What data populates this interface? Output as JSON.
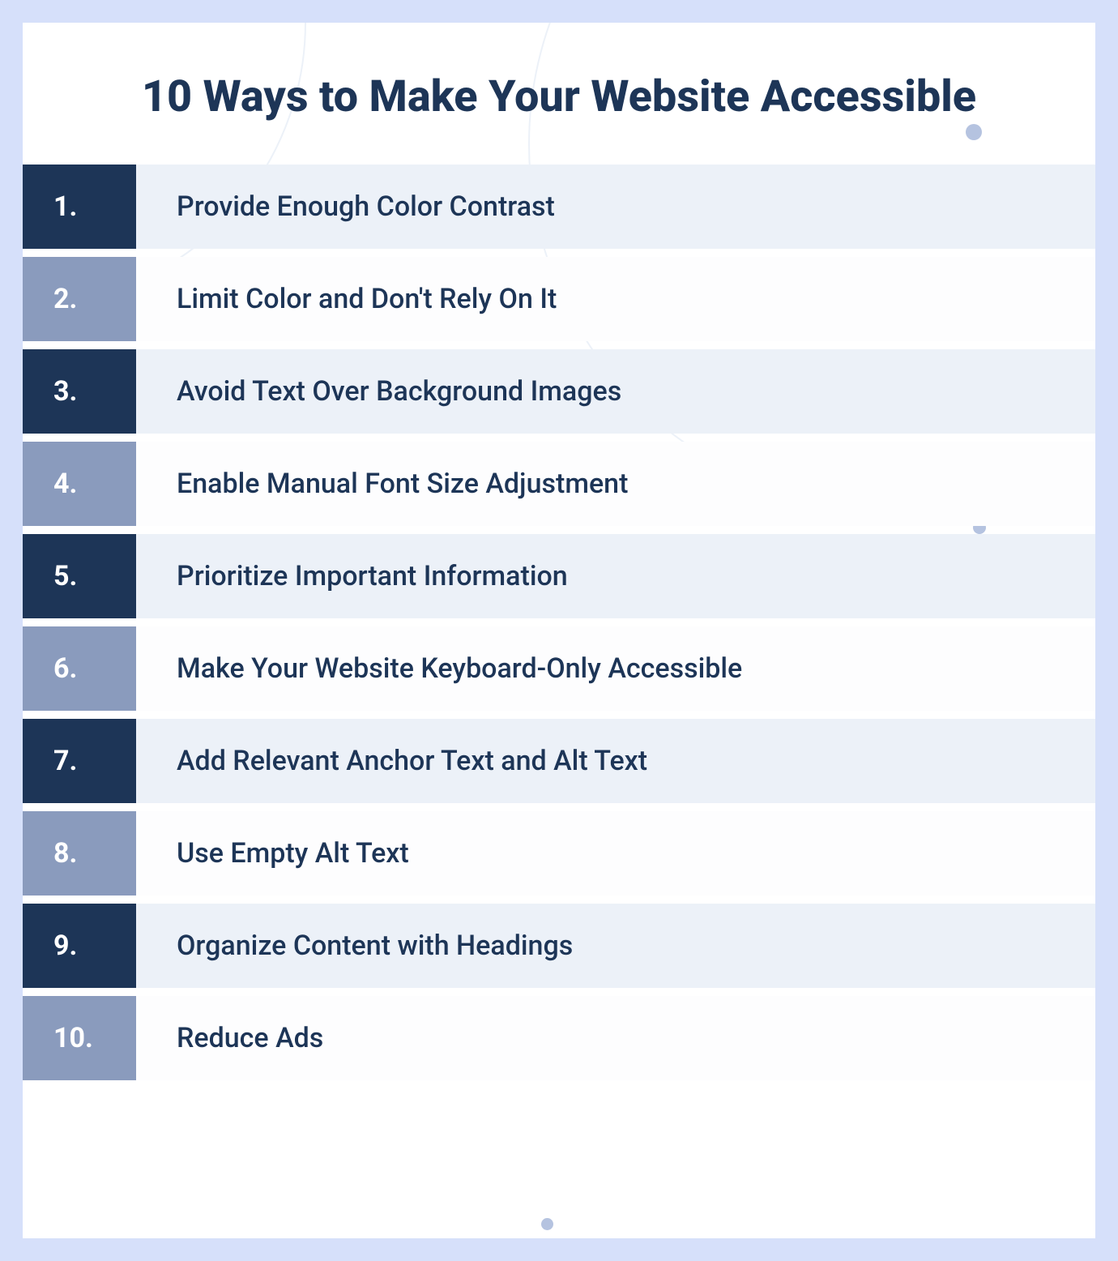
{
  "title": "10 Ways to Make Your Website Accessible",
  "items": [
    {
      "number": "1.",
      "text": "Provide Enough Color Contrast"
    },
    {
      "number": "2.",
      "text": "Limit Color and Don't Rely On It"
    },
    {
      "number": "3.",
      "text": "Avoid Text Over Background Images"
    },
    {
      "number": "4.",
      "text": "Enable Manual Font Size Adjustment"
    },
    {
      "number": "5.",
      "text": "Prioritize Important Information"
    },
    {
      "number": "6.",
      "text": "Make Your Website Keyboard-Only Accessible"
    },
    {
      "number": "7.",
      "text": "Add Relevant Anchor Text and Alt Text"
    },
    {
      "number": "8.",
      "text": "Use Empty Alt Text"
    },
    {
      "number": "9.",
      "text": "Organize Content with Headings"
    },
    {
      "number": "10.",
      "text": "Reduce Ads"
    }
  ]
}
